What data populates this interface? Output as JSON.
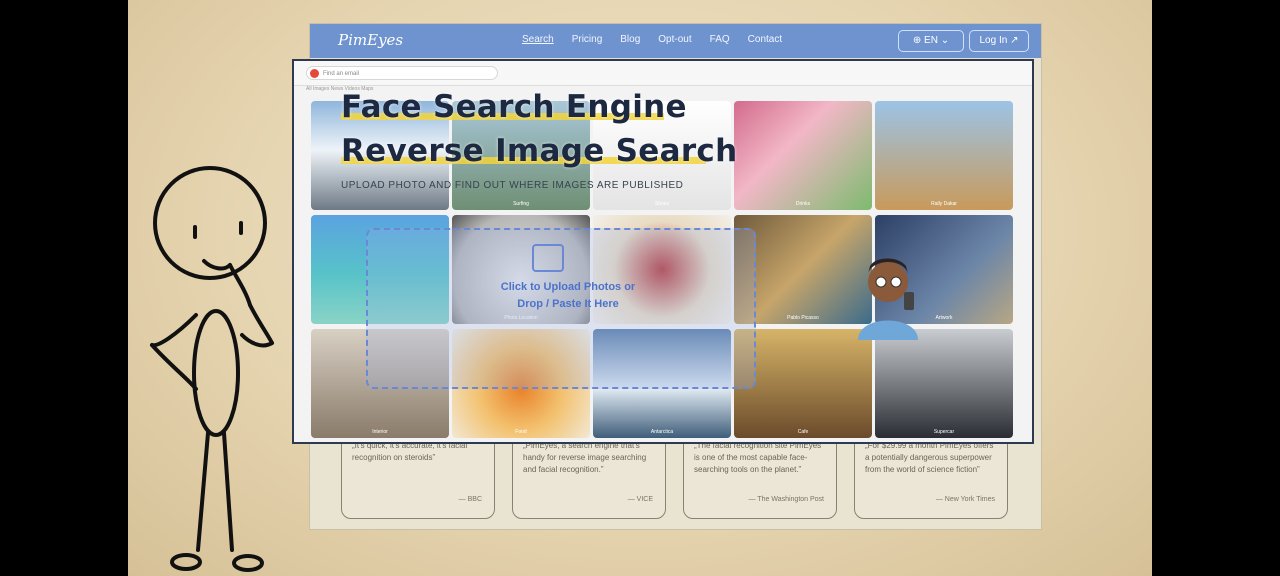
{
  "site": {
    "logo": "PimEyes",
    "nav": [
      "Search",
      "Pricing",
      "Blog",
      "Opt-out",
      "FAQ",
      "Contact"
    ],
    "lang": "EN",
    "login": "Log In"
  },
  "hero": {
    "line1": "Face Search Engine",
    "line2": "Reverse Image Search",
    "subtitle": "UPLOAD PHOTO AND FIND OUT WHERE IMAGES ARE PUBLISHED"
  },
  "upload": {
    "line1": "Click to Upload Photos or",
    "line2": "Drop / Paste It Here"
  },
  "browser": {
    "search_placeholder": "Find an email",
    "tabs": "All   Images   News   Videos   Maps"
  },
  "quotes": [
    {
      "text": "„It's quick, it's accurate, it's facial recognition on steroids”",
      "source": "— BBC"
    },
    {
      "text": "„PimEyes, a search engine that's handy for reverse image searching and facial recognition.”",
      "source": "— VICE"
    },
    {
      "text": "„The facial recognition site PimEyes is one of the most capable face-searching tools on the planet.”",
      "source": "— The Washington Post"
    },
    {
      "text": "„For $29.99 a month PimEyes offers a potentially dangerous superpower from the world of science fiction”",
      "source": "— New York Times"
    }
  ],
  "tiles": [
    {
      "bg": "linear-gradient(180deg,#8fb6dc 0%,#eef3f8 45%,#6d7a86 100%)",
      "cap": ""
    },
    {
      "bg": "linear-gradient(180deg,#a9c7d8 0%,#6f8f74 100%)",
      "cap": "Surfing"
    },
    {
      "bg": "linear-gradient(180deg,#ffffff 0%,#e4e4e4 100%)",
      "cap": "Shoes"
    },
    {
      "bg": "linear-gradient(135deg,#d36b8c 0%,#f2b7c7 40%,#7dbb6e 100%)",
      "cap": "Drinks"
    },
    {
      "bg": "linear-gradient(180deg,#9cc3e6 0%,#c89a5b 100%)",
      "cap": "Rally Dakar"
    },
    {
      "bg": "linear-gradient(180deg,#5aa3e0 0%,#58c3c9 55%,#89d3c6 100%)",
      "cap": ""
    },
    {
      "bg": "radial-gradient(circle at 50% 60%,#e8e8e8 0%,#b6b6b6 70%,#555 100%)",
      "cap": "Photo Location"
    },
    {
      "bg": "radial-gradient(circle at 50% 50%,#b83b3b 0%,#e9dcc4 55%,#f3efe8 100%)",
      "cap": ""
    },
    {
      "bg": "linear-gradient(135deg,#6f5a3b 0%,#c7a56a 50%,#3b6b8b 100%)",
      "cap": "Pablo Picasso"
    },
    {
      "bg": "linear-gradient(135deg,#2d3f66 0%,#6c86a8 60%,#b7a784 100%)",
      "cap": "Artwork"
    },
    {
      "bg": "linear-gradient(180deg,#d8d0c4 0%,#8a7b6a 100%)",
      "cap": "Interior"
    },
    {
      "bg": "radial-gradient(circle at 50% 55%,#e9822a 0%,#f3c16e 45%,#f2eee4 100%)",
      "cap": "Food"
    },
    {
      "bg": "linear-gradient(180deg,#5b7fa8 0%,#dfe9f1 55%,#3f5d7a 100%)",
      "cap": "Antarctica"
    },
    {
      "bg": "linear-gradient(180deg,#d6b468 0%,#6b4b2b 100%)",
      "cap": "Cafe"
    },
    {
      "bg": "linear-gradient(180deg,#c9ccd0 0%,#2a2d33 100%)",
      "cap": "Supercar"
    }
  ]
}
